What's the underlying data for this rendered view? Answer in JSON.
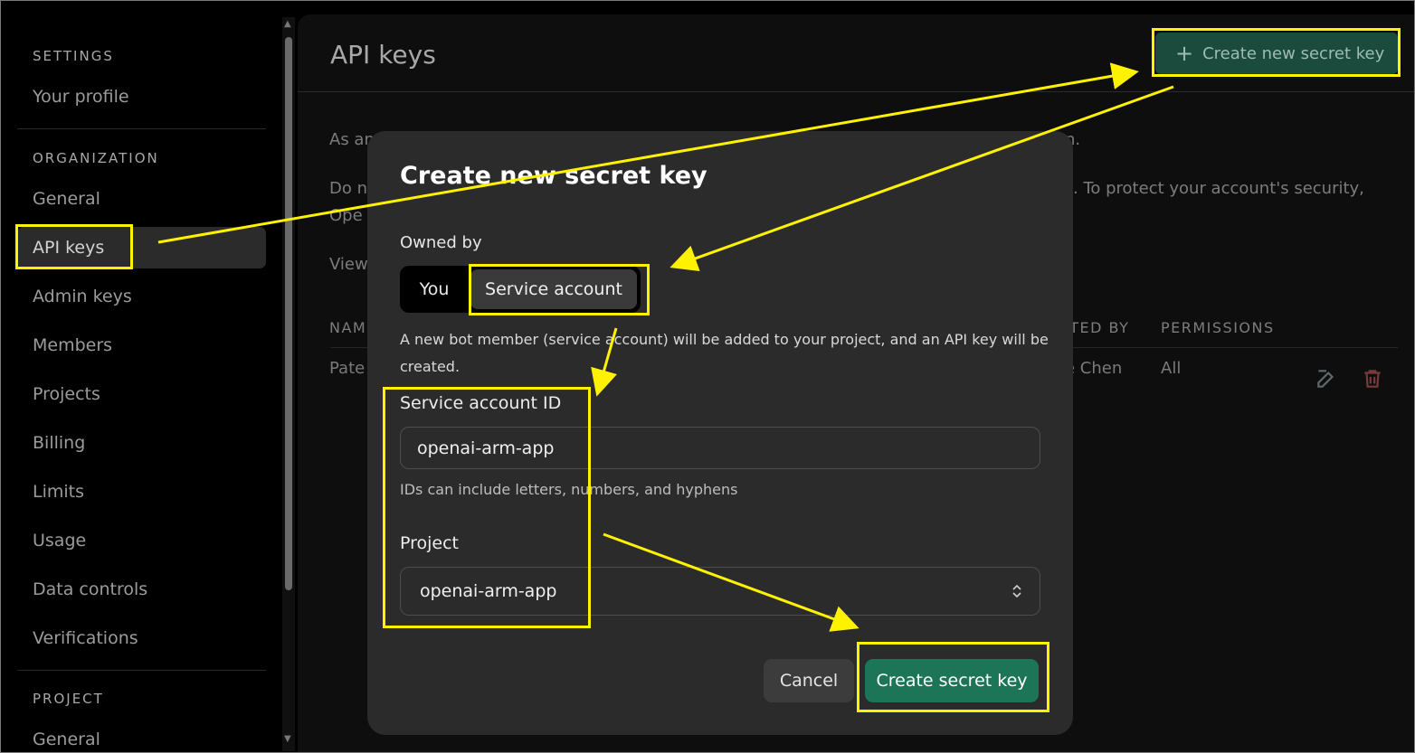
{
  "sidebar": {
    "sections": [
      {
        "title": "SETTINGS"
      },
      {
        "title": "ORGANIZATION"
      },
      {
        "title": "PROJECT"
      }
    ],
    "items": [
      {
        "label": "Your profile"
      },
      {
        "label": "General"
      },
      {
        "label": "API keys"
      },
      {
        "label": "Admin keys"
      },
      {
        "label": "Members"
      },
      {
        "label": "Projects"
      },
      {
        "label": "Billing"
      },
      {
        "label": "Limits"
      },
      {
        "label": "Usage"
      },
      {
        "label": "Data controls"
      },
      {
        "label": "Verifications"
      },
      {
        "label": "General"
      }
    ],
    "active_item": "API keys"
  },
  "main": {
    "title": "API keys",
    "create_button": "Create new secret key",
    "create_button_icon": "plus-icon",
    "paragraph1_start": "As an",
    "paragraph1_end": "n.",
    "paragraph2_start": "Do n",
    "paragraph2_end": ". To protect your account's security,",
    "paragraph2_line2": "Ope",
    "paragraph3_start": "View",
    "table": {
      "headers": [
        "NAM",
        "ATED BY",
        "PERMISSIONS"
      ],
      "row": {
        "name": "Pate",
        "created_by": "e Chen",
        "permissions": "All"
      },
      "row_icons": [
        "edit-icon",
        "trash-icon"
      ]
    }
  },
  "modal": {
    "title": "Create new secret key",
    "owned_by_label": "Owned by",
    "owner_options": [
      "You",
      "Service account"
    ],
    "owner_selected": "Service account",
    "owner_help": "A new bot member (service account) will be added to your project, and an API key will be created.",
    "service_id_label": "Service account ID",
    "service_id_value": "openai-arm-app",
    "service_id_help": "IDs can include letters, numbers, and hyphens",
    "project_label": "Project",
    "project_value": "openai-arm-app",
    "cancel_label": "Cancel",
    "submit_label": "Create secret key"
  },
  "colors": {
    "accent": "#1c7557",
    "annotation": "#fff200",
    "modal_bg": "#2b2b2b"
  }
}
